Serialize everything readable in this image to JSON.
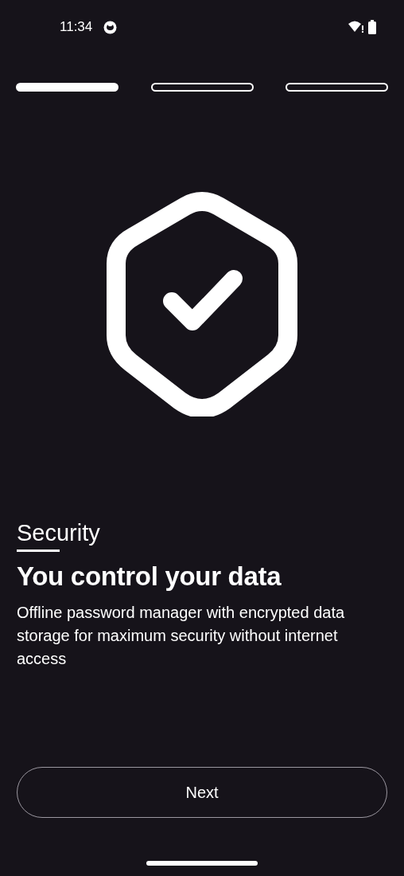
{
  "status_bar": {
    "time": "11:34"
  },
  "steps": [
    {
      "selected": true
    },
    {
      "selected": false
    },
    {
      "selected": false
    }
  ],
  "category": "Security",
  "title": "You control your data",
  "description": "Offline password manager with encrypted data storage for maximum security without internet access",
  "next_button": "Next"
}
